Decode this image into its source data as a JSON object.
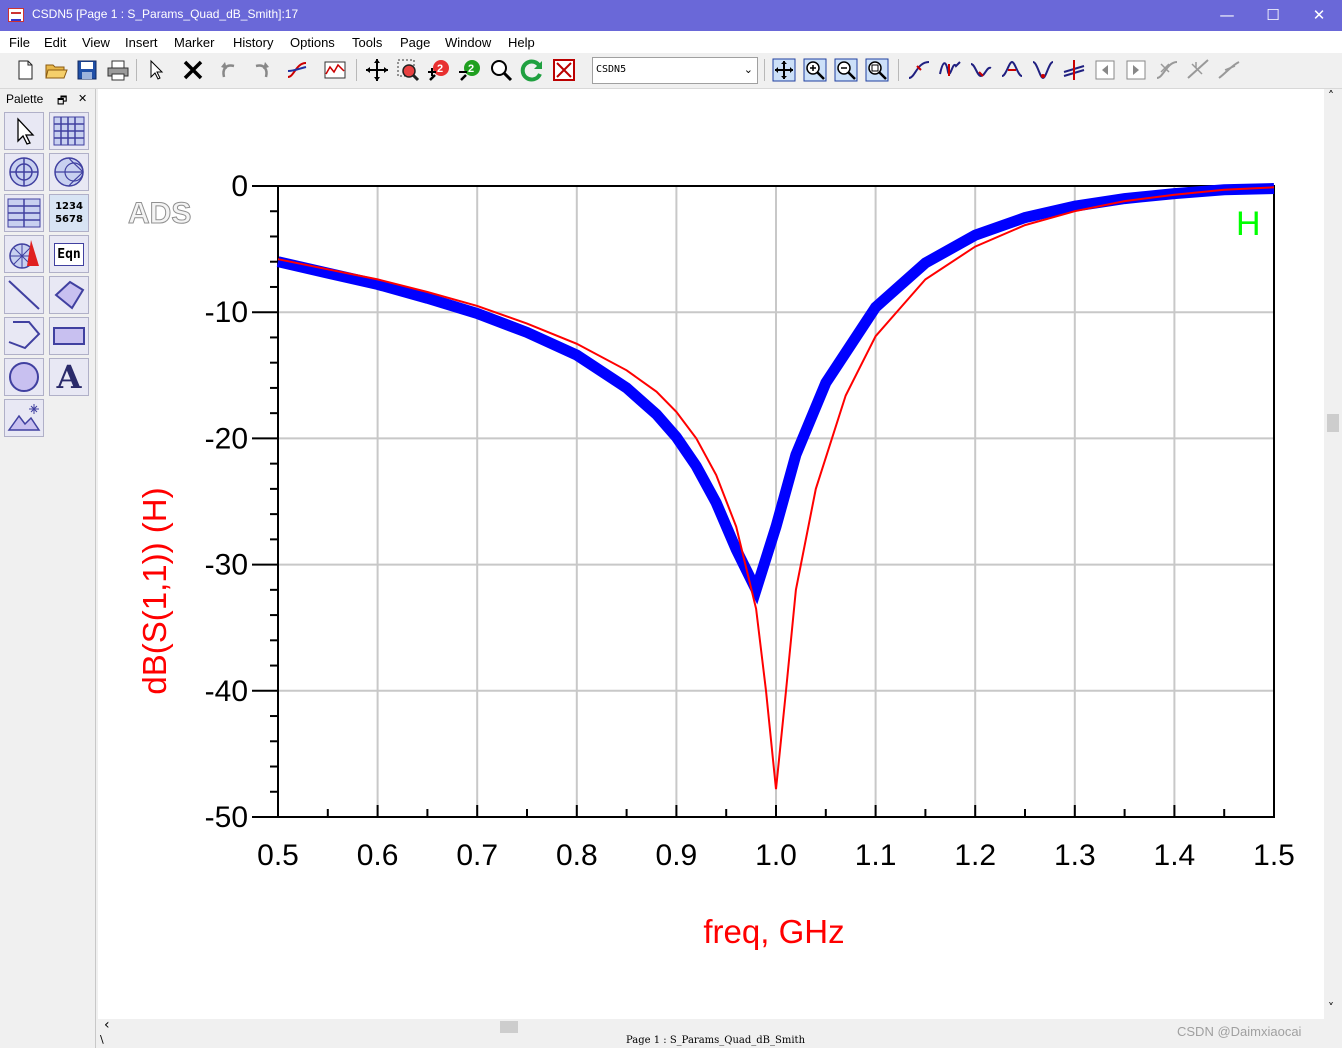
{
  "window": {
    "title": "CSDN5 [Page 1 : S_Params_Quad_dB_Smith]:17",
    "minimize_glyph": "—",
    "maximize_glyph": "☐",
    "close_glyph": "✕"
  },
  "menu": [
    "File",
    "Edit",
    "View",
    "Insert",
    "Marker",
    "History",
    "Options",
    "Tools",
    "Page",
    "Window",
    "Help"
  ],
  "toolbar": {
    "window_select_value": "CSDN5",
    "icons": [
      "new-file-icon",
      "open-folder-icon",
      "save-icon",
      "print-icon",
      "select-arrow-icon",
      "delete-icon",
      "undo-icon",
      "redo-icon",
      "trace-icon",
      "plot-options-icon",
      "pan-icon",
      "zoom-area-icon",
      "zoom-in-2x-icon",
      "zoom-out-2x-icon",
      "zoom-icon",
      "refresh-icon",
      "cancel-icon",
      "view-all-icon",
      "zoom-in-view-icon",
      "zoom-out-view-icon",
      "zoom-fit-icon",
      "marker-trace-icon",
      "marker-wave-icon",
      "marker-min-icon",
      "marker-delta-icon",
      "marker-valley-icon",
      "marker-cross-icon",
      "marker-prev-icon",
      "marker-next-icon",
      "marker-move-icon",
      "marker-line-icon",
      "marker-slope-icon"
    ]
  },
  "palette": {
    "title": "Palette",
    "restore_glyph": "🗗",
    "close_glyph": "✕",
    "tools": [
      "pointer-tool",
      "rectangular-plot-tool",
      "polar-plot-tool",
      "smith-chart-tool",
      "list-tool",
      "stacked-list-tool",
      "antenna-plot-tool",
      "equation-tool",
      "line-tool",
      "polygon-tool",
      "polyline-tool",
      "rectangle-tool",
      "circle-tool",
      "text-tool",
      "image-tool"
    ],
    "stacked_list_label": "1234\n5678",
    "equation_label": "Eqn",
    "text_tool_label": "A"
  },
  "plot": {
    "ads_logo": "ADS",
    "legend_label": "H",
    "legend_color": "#00ff00",
    "grid": true
  },
  "chart_data": {
    "type": "line",
    "title": "",
    "xlabel": "freq, GHz",
    "ylabel": "dB(S(1,1)) (H)",
    "xlim": [
      0.5,
      1.5
    ],
    "ylim": [
      -50,
      0
    ],
    "xticks": [
      "0.5",
      "0.6",
      "0.7",
      "0.8",
      "0.9",
      "1.0",
      "1.1",
      "1.2",
      "1.3",
      "1.4",
      "1.5"
    ],
    "yticks": [
      "0",
      "-10",
      "-20",
      "-30",
      "-40",
      "-50"
    ],
    "series": [
      {
        "color": "#0000ff",
        "x": [
          0.5,
          0.55,
          0.6,
          0.65,
          0.7,
          0.75,
          0.8,
          0.85,
          0.88,
          0.9,
          0.92,
          0.94,
          0.96,
          0.98,
          1.0,
          1.02,
          1.05,
          1.1,
          1.15,
          1.2,
          1.25,
          1.3,
          1.35,
          1.4,
          1.45,
          1.5
        ],
        "y": [
          -6.0,
          -6.9,
          -7.8,
          -8.9,
          -10.1,
          -11.6,
          -13.4,
          -16.0,
          -18.1,
          -19.9,
          -22.2,
          -25.1,
          -28.8,
          -32.0,
          -27.0,
          -21.3,
          -15.6,
          -9.6,
          -6.1,
          -3.9,
          -2.5,
          -1.6,
          -1.0,
          -0.6,
          -0.3,
          -0.2
        ]
      },
      {
        "color": "#ff0000",
        "x": [
          0.5,
          0.55,
          0.6,
          0.65,
          0.7,
          0.75,
          0.8,
          0.85,
          0.88,
          0.9,
          0.92,
          0.94,
          0.96,
          0.98,
          0.99,
          1.0,
          1.01,
          1.02,
          1.04,
          1.07,
          1.1,
          1.15,
          1.2,
          1.25,
          1.3,
          1.35,
          1.4,
          1.45,
          1.5
        ],
        "y": [
          -5.8,
          -6.6,
          -7.4,
          -8.4,
          -9.5,
          -10.9,
          -12.5,
          -14.6,
          -16.3,
          -17.9,
          -20.0,
          -22.9,
          -27.0,
          -33.5,
          -40.0,
          -47.8,
          -40.0,
          -32.0,
          -24.0,
          -16.6,
          -11.9,
          -7.4,
          -4.8,
          -3.1,
          -2.0,
          -1.2,
          -0.7,
          -0.3,
          -0.1
        ]
      }
    ]
  },
  "statusbar": {
    "page_label": "Page 1 : S_Params_Quad_dB_Smith",
    "watermark": "CSDN @Daimxiaocai"
  },
  "scroll": {
    "left_arrow": "‹",
    "up_arrow": "˄",
    "down_arrow": "˅",
    "status_left": "\\"
  }
}
